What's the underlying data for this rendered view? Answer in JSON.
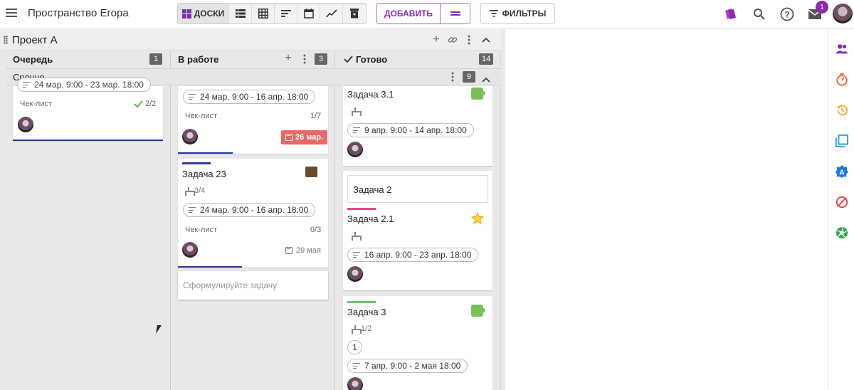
{
  "app": {
    "title": "Пространство Егора"
  },
  "toolbar": {
    "boards_label": "ДОСКИ",
    "add_label": "ДОБАВИТЬ",
    "filters_label": "ФИЛЬТРЫ",
    "mail_badge": "1",
    "icons": [
      "list-icon",
      "table-icon",
      "gantt-icon",
      "calendar-icon",
      "chart-icon",
      "archive-icon"
    ]
  },
  "project": {
    "title": "Проект А"
  },
  "columns": [
    {
      "title": "Очередь",
      "count": "1"
    },
    {
      "title": "В работе",
      "count": "3"
    },
    {
      "title": "Готово",
      "count": "14"
    }
  ],
  "swimlane": {
    "title": "Срочно",
    "count": "9"
  },
  "queue_card": {
    "partial_date": "24 мар. 9:00 - 23 мар. 18:00",
    "checklist_label": "Чек-лист",
    "checklist_value": "2/2"
  },
  "work_cards": {
    "card1": {
      "date": "24 мар. 9:00 - 16 апр. 18:00",
      "checklist_label": "Чек-лист",
      "checklist_value": "1/7",
      "deadline": "26 мар."
    },
    "card2": {
      "title": "Задача 23",
      "subtasks": "3/4",
      "date": "24 мар. 9:00 - 16 апр. 18:00",
      "checklist_label": "Чек-лист",
      "checklist_value": "0/3",
      "deadline": "29 мая"
    },
    "new_task_placeholder": "Сформулируйте задачу"
  },
  "done_cards": {
    "card1": {
      "title": "Задача 3.1",
      "date": "9 апр. 9:00 - 14 апр. 18:00"
    },
    "card2": {
      "title": "Задача 2"
    },
    "card3": {
      "title": "Задача 2.1",
      "date": "16 апр. 9:00 - 23 апр. 18:00"
    },
    "card4": {
      "title": "Задача 3",
      "subtasks": "1/2",
      "number": "1",
      "date": "7 апр. 9:00 - 2 мая 18:00"
    }
  },
  "colors": {
    "accent": "#8e2ab0",
    "progress": "#2b3a99",
    "deadline": "#e86868",
    "strip_blue": "#2b3a99",
    "strip_pink": "#e04a8a",
    "strip_green": "#6cc36c"
  }
}
